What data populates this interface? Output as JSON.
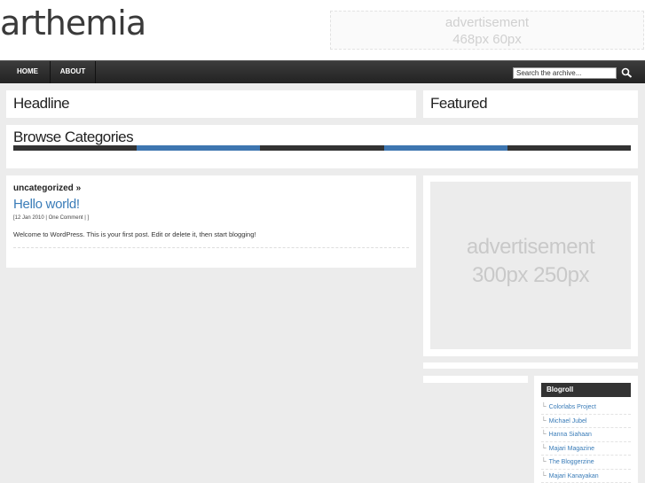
{
  "header": {
    "logo": "arthemia",
    "ad_top_line1": "advertisement",
    "ad_top_line2": "468px 60px"
  },
  "nav": {
    "home": "HOME",
    "about": "ABOUT",
    "search_value": "Search the archive..."
  },
  "headline_title": "Headline",
  "featured_title": "Featured",
  "browse_title": "Browse Categories",
  "category_bar_colors": [
    "#333333",
    "#3e76b0",
    "#333333",
    "#3e76b0",
    "#333333"
  ],
  "post": {
    "category": "uncategorized »",
    "title": "Hello world!",
    "meta": "[12 Jan 2010 | One Comment | ]",
    "excerpt": "Welcome to WordPress. This is your first post. Edit or delete it, then start blogging!"
  },
  "ad_side": {
    "line1": "advertisement",
    "line2": "300px 250px"
  },
  "blogroll": {
    "title": "Blogroll",
    "links": [
      "Colorlabs Project",
      "Michael Jubel",
      "Hanna Siahaan",
      "Majari Magazine",
      "The Bloggerzine",
      "Majari Kanayakan"
    ]
  }
}
